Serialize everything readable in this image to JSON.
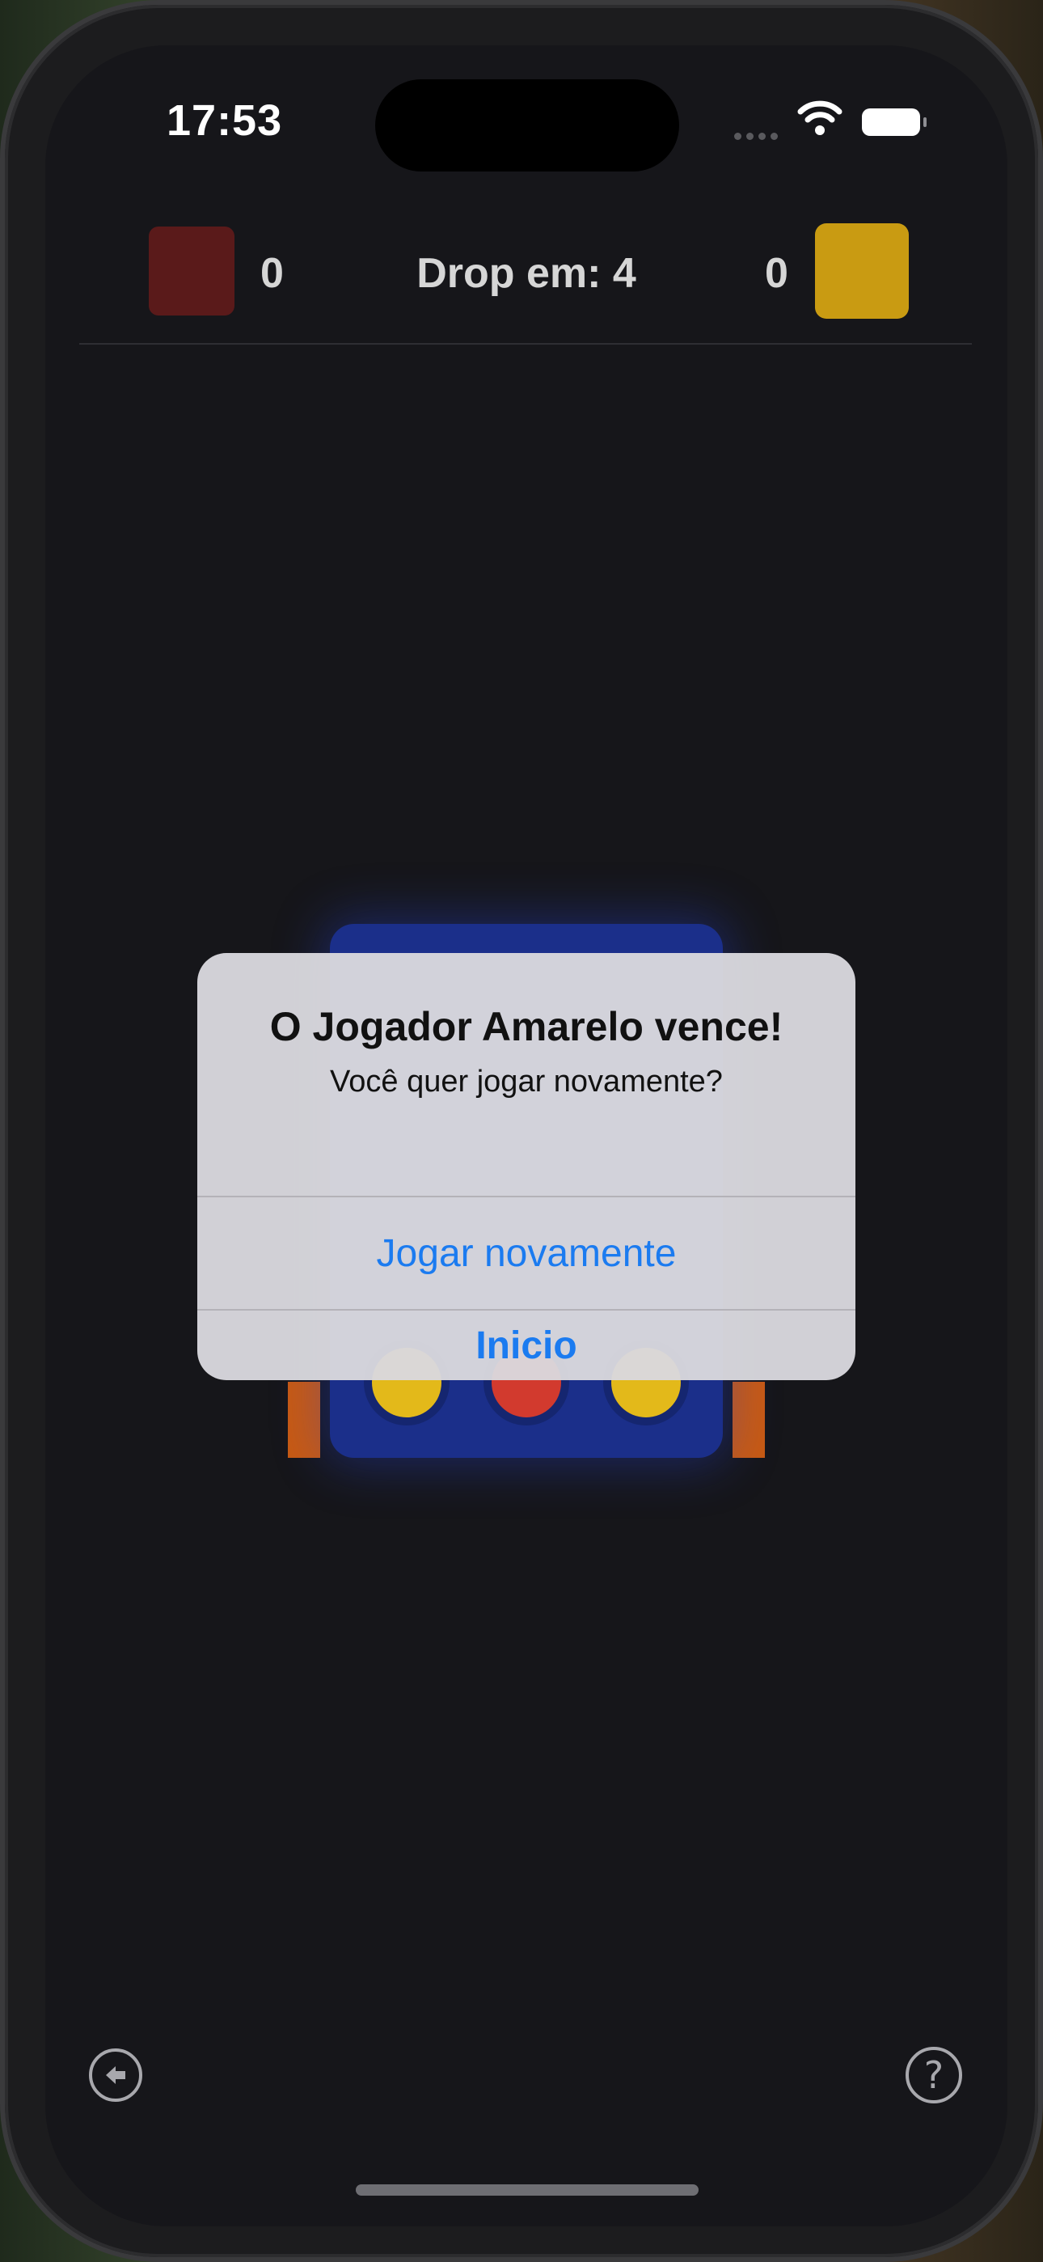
{
  "status_bar": {
    "time": "17:53",
    "icons": [
      "cellular-icon",
      "wifi-icon",
      "battery-icon"
    ]
  },
  "header": {
    "red_score": "0",
    "drop_label": "Drop em: 4",
    "yellow_score": "0",
    "red_color": "#5a1a1a",
    "yellow_color": "#c99b12"
  },
  "alert": {
    "title": "O Jogador Amarelo vence!",
    "message": "Você quer jogar novamente?",
    "play_again_label": "Jogar novamente",
    "home_label": "Inicio",
    "accent_color": "#1b7bf0"
  },
  "footer": {
    "back_icon": "arrow-left-circle-icon",
    "help_label": "?"
  }
}
